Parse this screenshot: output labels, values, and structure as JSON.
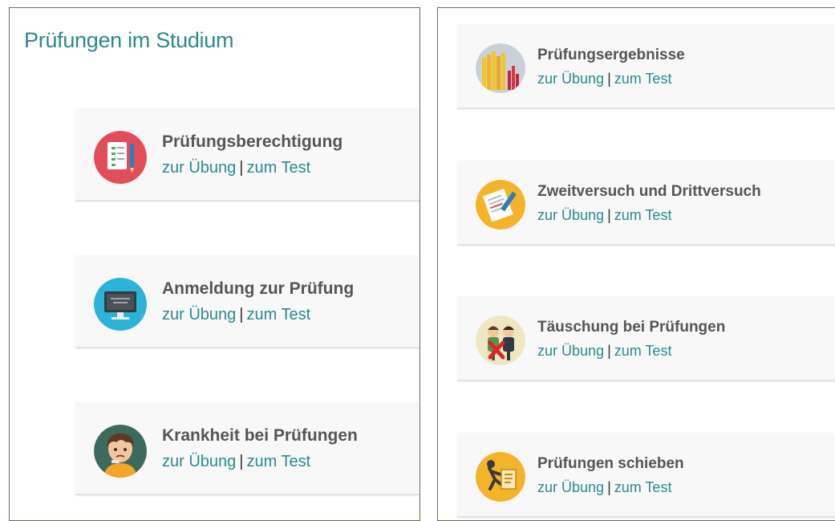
{
  "page_title": "Prüfungen im Studium",
  "links": {
    "practice": "zur Übung",
    "separator": "|",
    "test": "zum Test"
  },
  "cards": [
    {
      "title": "Prüfungsberechtigung",
      "icon": "checklist-pencil-icon",
      "icon_color": "#e14e5a"
    },
    {
      "title": "Anmeldung zur Prüfung",
      "icon": "monitor-icon",
      "icon_color": "#2bb3d8"
    },
    {
      "title": "Krankheit bei Prüfungen",
      "icon": "sick-student-icon",
      "icon_color": "#3c6b5d"
    },
    {
      "title": "Prüfungsergebnisse",
      "icon": "results-chart-icon",
      "icon_color": "#c9d1d8"
    },
    {
      "title": "Zweitversuch und Drittversuch",
      "icon": "document-pen-icon",
      "icon_color": "#f3b42a"
    },
    {
      "title": "Täuschung bei Prüfungen",
      "icon": "cheating-students-icon",
      "icon_color": "#f0e7c2"
    },
    {
      "title": "Prüfungen schieben",
      "icon": "postpone-exam-icon",
      "icon_color": "#f3b42a"
    }
  ]
}
